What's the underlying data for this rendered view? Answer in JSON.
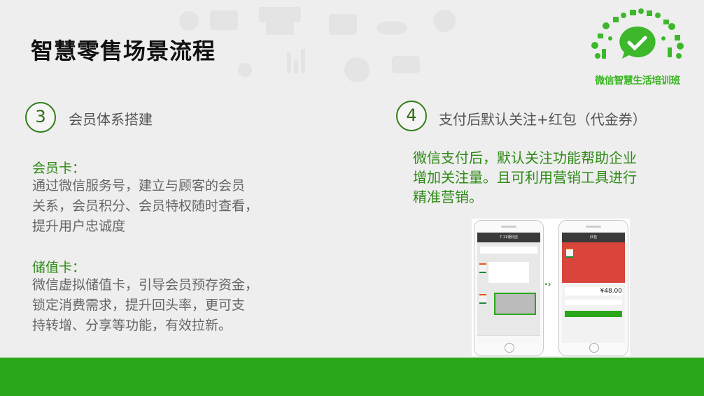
{
  "title": "智慧零售场景流程",
  "logo_text": "微信智慧生活培训班",
  "section3": {
    "number": "3",
    "heading": "会员体系搭建",
    "card1_label": "会员卡：",
    "card1_lines": [
      "通过微信服务号，建立与顾客的会员",
      "关系，会员积分、会员特权随时查看，",
      "提升用户忠诚度"
    ],
    "card2_label": "储值卡：",
    "card2_lines": [
      "微信虚拟储值卡，引导会员预存资金，",
      "锁定消费需求，提升回头率，更可支",
      "持转增、分享等功能，有效拉新。"
    ]
  },
  "section4": {
    "number": "4",
    "heading": "支付后默认关注+红包（代金券）",
    "lines": [
      "微信支付后，默认关注功能帮助企业",
      "增加关注量。且可利用营销工具进行",
      "精准营销。"
    ]
  },
  "phone1": {
    "nav_title": "7-11便利店"
  },
  "phone2": {
    "nav_title": "红包",
    "amount": "¥48.00"
  },
  "colors": {
    "accent": "#2e8a16",
    "footer": "#2aa71a"
  }
}
